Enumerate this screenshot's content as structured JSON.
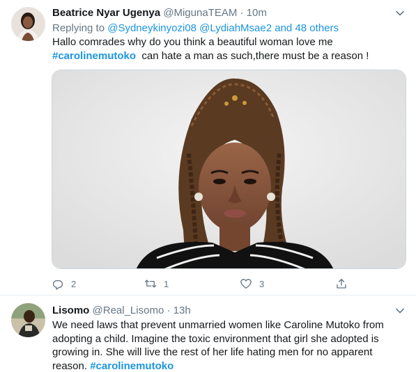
{
  "tweets": [
    {
      "name": "Beatrice Nyar Ugenya",
      "handle": "@MigunaTEAM",
      "separator": "·",
      "time": "10m",
      "replying_prefix": "Replying to ",
      "replying_users": "@Sydneykinyozi08 @LydiahMsae2",
      "replying_and": " and ",
      "replying_others": "48 others",
      "text_line1": "Hallo comrades why do you think a beautiful woman love me",
      "hashtag": "#carolinemutoko",
      "text_line2_rest": "  can hate a man as such,there must be a reason !",
      "actions": {
        "reply_count": "2",
        "retweet_count": "1",
        "like_count": "3"
      },
      "icons": {
        "reply": "reply-icon",
        "retweet": "retweet-icon",
        "like": "heart-icon",
        "share": "share-icon",
        "more": "chevron-down-icon"
      }
    },
    {
      "name": "Lisomo",
      "handle": "@Real_Lisomo",
      "separator": "·",
      "time": "13h",
      "text": "We need laws that prevent unmarried women like Caroline Mutoko from adopting a child. Imagine the toxic environment that girl she adopted is growing in. She will live the rest of her life hating men for no apparent reason.",
      "hashtag": "#carolinemutoko"
    }
  ],
  "colors": {
    "link": "#1b95e0",
    "secondary_text": "#657786",
    "primary_text": "#14171a",
    "border": "#e6ecf0"
  }
}
